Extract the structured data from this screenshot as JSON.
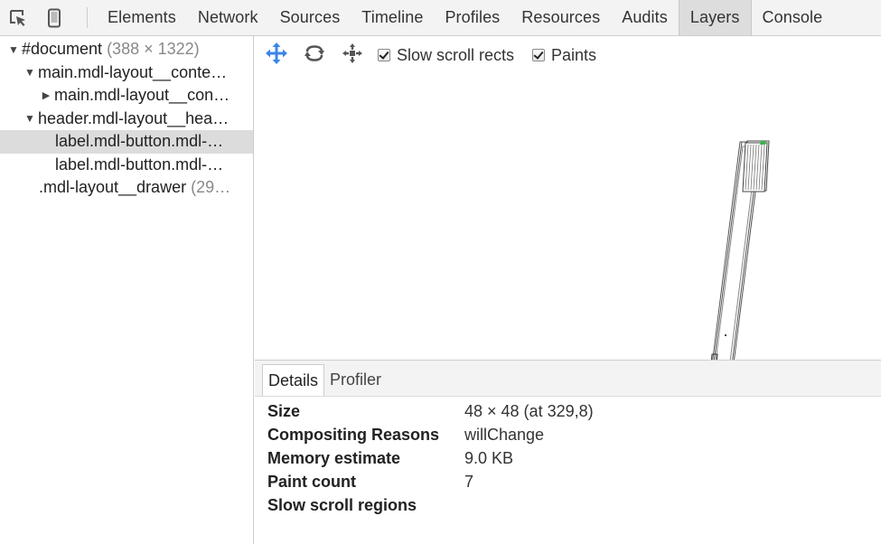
{
  "toolbar": {
    "inspect_icon": "inspect-element-icon",
    "device_icon": "device-mode-icon",
    "tabs": [
      {
        "label": "Elements"
      },
      {
        "label": "Network"
      },
      {
        "label": "Sources"
      },
      {
        "label": "Timeline"
      },
      {
        "label": "Profiles"
      },
      {
        "label": "Resources"
      },
      {
        "label": "Audits"
      },
      {
        "label": "Layers",
        "selected": true
      },
      {
        "label": "Console"
      }
    ]
  },
  "tree": {
    "rows": [
      {
        "arrow": "▼",
        "label": "#document",
        "dim": " (388 × 1322)"
      },
      {
        "arrow": "▼",
        "label": "main.mdl-layout__conte…",
        "dim": ""
      },
      {
        "arrow": "▶",
        "label": "main.mdl-layout__con…",
        "dim": ""
      },
      {
        "arrow": "▼",
        "label": "header.mdl-layout__hea…",
        "dim": ""
      },
      {
        "arrow": "",
        "label": "label.mdl-button.mdl-…",
        "dim": ""
      },
      {
        "arrow": "",
        "label": "label.mdl-button.mdl-…",
        "dim": ""
      },
      {
        "arrow": "",
        "label": ".mdl-layout__drawer",
        "dim": " (29…"
      }
    ]
  },
  "layer_toolbar": {
    "pan_icon": "pan-mode-icon",
    "rotate_icon": "rotate-mode-icon",
    "reset_icon": "reset-transform-icon",
    "slow_scroll_label": "Slow scroll rects",
    "slow_scroll_checked": true,
    "paints_label": "Paints",
    "paints_checked": true
  },
  "details": {
    "tabs": [
      {
        "label": "Details",
        "selected": true
      },
      {
        "label": "Profiler"
      }
    ],
    "rows": [
      {
        "key": "Size",
        "value": "48 × 48 (at 329,8)"
      },
      {
        "key": "Compositing Reasons",
        "value": "willChange"
      },
      {
        "key": "Memory estimate",
        "value": "9.0 KB"
      },
      {
        "key": "Paint count",
        "value": "7"
      },
      {
        "key": "Slow scroll regions",
        "value": ""
      }
    ]
  },
  "colors": {
    "accent_blue": "#3b86e8",
    "selected_tab_bg": "#dddddd",
    "selected_row_bg": "#dcdcdc"
  }
}
